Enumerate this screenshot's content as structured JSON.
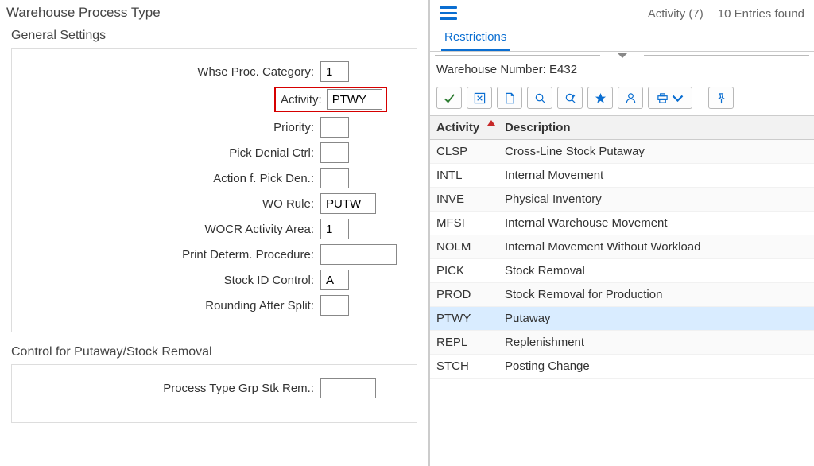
{
  "left": {
    "section_title": "Warehouse Process Type",
    "general_title": "General Settings",
    "fields": {
      "whse_cat_label": "Whse Proc. Category:",
      "whse_cat_value": "1",
      "activity_label": "Activity:",
      "activity_value": "PTWY",
      "priority_label": "Priority:",
      "priority_value": "",
      "pick_denial_label": "Pick Denial Ctrl:",
      "pick_denial_value": "",
      "action_pick_den_label": "Action f. Pick Den.:",
      "action_pick_den_value": "",
      "wo_rule_label": "WO Rule:",
      "wo_rule_value": "PUTW",
      "wocr_area_label": "WOCR Activity Area:",
      "wocr_area_value": "1",
      "print_proc_label": "Print Determ. Procedure:",
      "print_proc_value": "",
      "stock_id_label": "Stock ID Control:",
      "stock_id_value": "A",
      "rounding_label": "Rounding After Split:",
      "rounding_value": ""
    },
    "control_title": "Control for Putaway/Stock Removal",
    "control_fields": {
      "proc_type_grp_label": "Process Type Grp Stk Rem.:",
      "proc_type_grp_value": ""
    }
  },
  "right": {
    "header_activity": "Activity (7)",
    "header_entries": "10 Entries found",
    "tab_restrictions": "Restrictions",
    "wh_number_label": "Warehouse Number:",
    "wh_number_value": "E432",
    "col_activity": "Activity",
    "col_desc": "Description",
    "selected": "PTWY",
    "rows": [
      {
        "code": "CLSP",
        "desc": "Cross-Line Stock Putaway"
      },
      {
        "code": "INTL",
        "desc": "Internal Movement"
      },
      {
        "code": "INVE",
        "desc": "Physical Inventory"
      },
      {
        "code": "MFSI",
        "desc": "Internal Warehouse Movement"
      },
      {
        "code": "NOLM",
        "desc": "Internal Movement Without Workload"
      },
      {
        "code": "PICK",
        "desc": "Stock Removal"
      },
      {
        "code": "PROD",
        "desc": "Stock Removal for Production"
      },
      {
        "code": "PTWY",
        "desc": "Putaway"
      },
      {
        "code": "REPL",
        "desc": "Replenishment"
      },
      {
        "code": "STCH",
        "desc": "Posting Change"
      }
    ]
  }
}
